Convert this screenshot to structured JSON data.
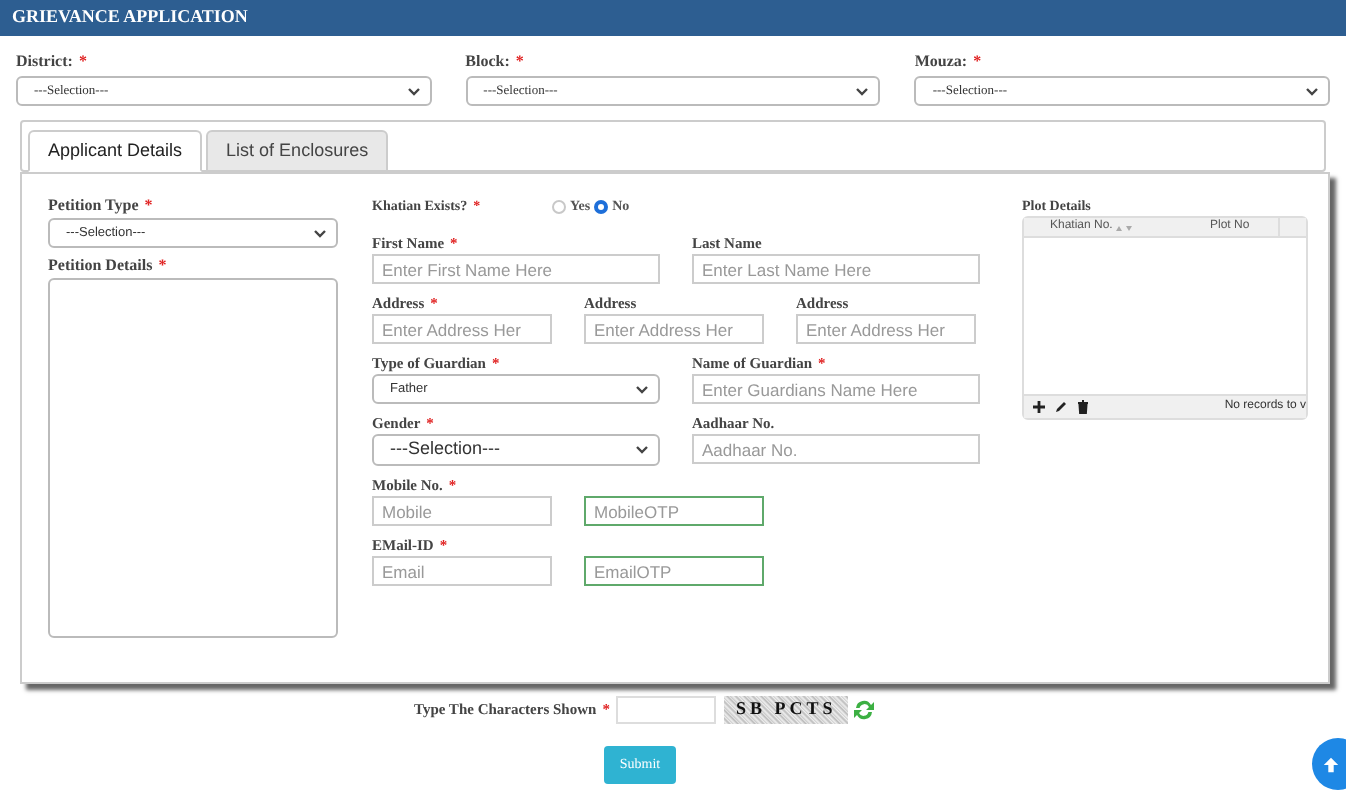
{
  "header": {
    "title": "GRIEVANCE APPLICATION"
  },
  "filters": [
    {
      "label": "District:",
      "mark": "*",
      "value": "---Selection---"
    },
    {
      "label": "Block:",
      "mark": "*",
      "value": "---Selection---"
    },
    {
      "label": "Mouza:",
      "mark": "*",
      "value": "---Selection---"
    }
  ],
  "tabs": [
    {
      "label": "Applicant Details",
      "selected": true
    },
    {
      "label": "List of Enclosures",
      "selected": false
    }
  ],
  "petition_type": {
    "label": "Petition Type",
    "mark": "*",
    "value": "---Selection---"
  },
  "petition_details": {
    "label": "Petition Details",
    "mark": "*"
  },
  "khatian_exists": {
    "label": "Khatian Exists?",
    "mark": "*",
    "options": [
      {
        "label": "Yes",
        "selected": false
      },
      {
        "label": "No",
        "selected": true
      }
    ]
  },
  "field_rows": [
    [
      {
        "kind": "input",
        "label": "First Name",
        "mark": "*",
        "placeholder": "Enter First Name Here"
      },
      {
        "kind": "input",
        "label": "Last Name",
        "placeholder": "Enter Last Name Here"
      }
    ],
    [
      {
        "kind": "input",
        "label": "Address",
        "mark": "*",
        "placeholder": "Enter Address Her"
      },
      {
        "kind": "input",
        "label": "Address",
        "placeholder": "Enter Address Her"
      },
      {
        "kind": "input",
        "label": "Address",
        "placeholder": "Enter Address Her"
      }
    ],
    [
      {
        "kind": "select",
        "label": "Type of Guardian",
        "mark": "*",
        "value": "Father"
      },
      {
        "kind": "input",
        "label": "Name of Guardian",
        "mark": "*",
        "placeholder": "Enter Guardians Name Here"
      }
    ],
    [
      {
        "kind": "select_large",
        "label": "Gender",
        "mark": "*",
        "value": "---Selection---"
      },
      {
        "kind": "input",
        "label": "Aadhaar No.",
        "placeholder": "Aadhaar No."
      }
    ],
    [
      {
        "kind": "input",
        "label": "Mobile No.",
        "mark": "*",
        "placeholder": "Mobile"
      },
      {
        "kind": "otp",
        "placeholder": "MobileOTP"
      }
    ],
    [
      {
        "kind": "input",
        "label": "EMail-ID",
        "mark": "*",
        "placeholder": "Email"
      },
      {
        "kind": "otp",
        "placeholder": "EmailOTP"
      }
    ]
  ],
  "plot_details": {
    "label": "Plot Details",
    "columns": [
      "Khatian No.",
      "Plot No"
    ],
    "pager_text": "No records to v"
  },
  "captcha": {
    "label": "Type The Characters Shown",
    "mark": "*",
    "code": "SB PCTS"
  },
  "submit": "Submit"
}
